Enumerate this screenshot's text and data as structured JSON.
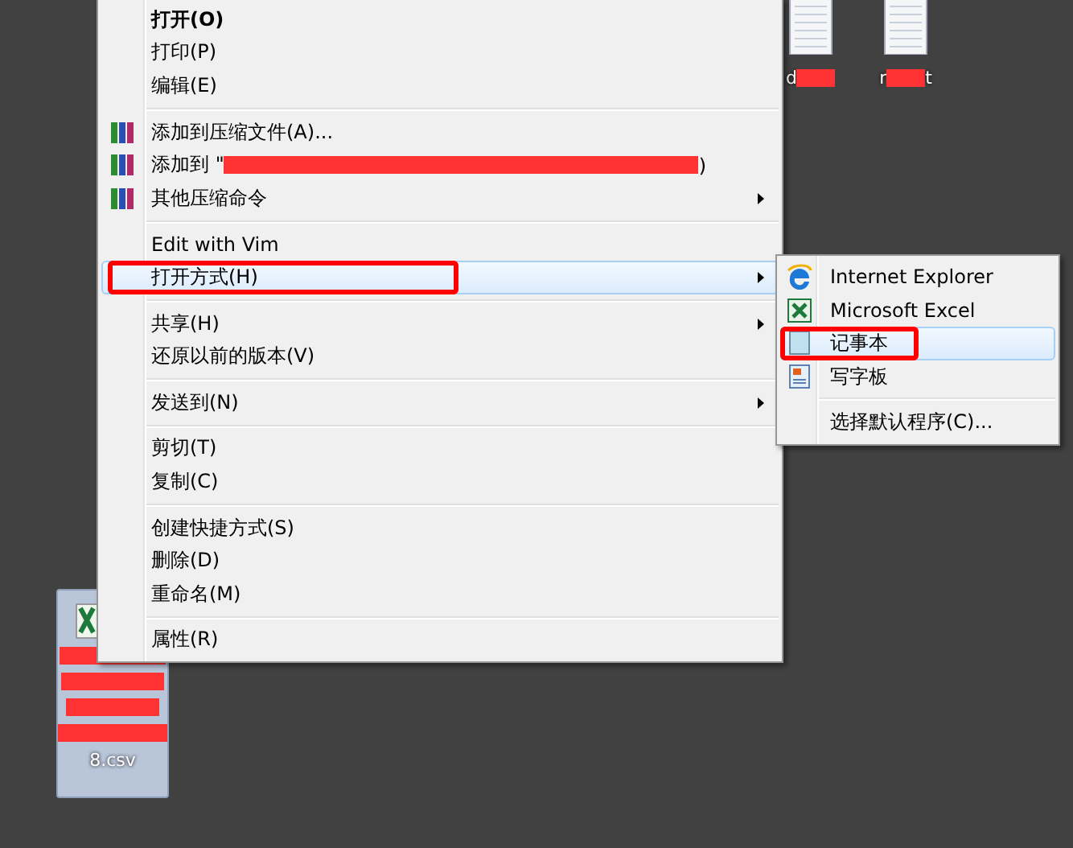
{
  "desktop_files": [
    {
      "kind": "text",
      "label_start": "d",
      "selected": false
    },
    {
      "kind": "text",
      "label_start": "r",
      "label_end": "t",
      "selected": false
    },
    {
      "kind": "excel",
      "label_end": "8.csv",
      "selected": true
    }
  ],
  "context_menu": {
    "groups": [
      [
        {
          "label": "打开(O)",
          "bold": true,
          "submenu": false,
          "selected": false,
          "annotated": false
        },
        {
          "label": "打印(P)",
          "bold": false,
          "submenu": false,
          "selected": false,
          "annotated": false
        },
        {
          "label": "编辑(E)",
          "bold": false,
          "submenu": false,
          "selected": false,
          "annotated": false
        }
      ],
      [
        {
          "label": "添加到压缩文件(A)...",
          "kind": "archive",
          "bold": false,
          "submenu": false,
          "selected": false,
          "annotated": false
        },
        {
          "label": "添加到 \"",
          "label_end": ")",
          "kind": "archive",
          "bold": false,
          "submenu": false,
          "selected": false,
          "annotated": false
        },
        {
          "label": "其他压缩命令",
          "kind": "archive",
          "bold": false,
          "submenu": true,
          "selected": false,
          "annotated": false
        }
      ],
      [
        {
          "label": "Edit with Vim",
          "bold": false,
          "submenu": false,
          "selected": false,
          "annotated": false
        },
        {
          "label": "打开方式(H)",
          "bold": false,
          "submenu": true,
          "selected": true,
          "annotated": true
        }
      ],
      [
        {
          "label": "共享(H)",
          "bold": false,
          "submenu": true,
          "selected": false,
          "annotated": false
        },
        {
          "label": "还原以前的版本(V)",
          "bold": false,
          "submenu": false,
          "selected": false,
          "annotated": false
        }
      ],
      [
        {
          "label": "发送到(N)",
          "bold": false,
          "submenu": true,
          "selected": false,
          "annotated": false
        }
      ],
      [
        {
          "label": "剪切(T)",
          "bold": false,
          "submenu": false,
          "selected": false,
          "annotated": false
        },
        {
          "label": "复制(C)",
          "bold": false,
          "submenu": false,
          "selected": false,
          "annotated": false
        }
      ],
      [
        {
          "label": "创建快捷方式(S)",
          "bold": false,
          "submenu": false,
          "selected": false,
          "annotated": false
        },
        {
          "label": "删除(D)",
          "bold": false,
          "submenu": false,
          "selected": false,
          "annotated": false
        },
        {
          "label": "重命名(M)",
          "bold": false,
          "submenu": false,
          "selected": false,
          "annotated": false
        }
      ],
      [
        {
          "label": "属性(R)",
          "bold": false,
          "submenu": false,
          "selected": false,
          "annotated": false
        }
      ]
    ]
  },
  "open_with_menu": {
    "groups": [
      [
        {
          "label": "Internet Explorer",
          "kind": "ie",
          "selected": false,
          "annotated": false
        },
        {
          "label": "Microsoft Excel",
          "kind": "excel",
          "selected": false,
          "annotated": false
        },
        {
          "label": "记事本",
          "kind": "notepad",
          "selected": true,
          "annotated": true
        },
        {
          "label": "写字板",
          "kind": "wordpad",
          "selected": false,
          "annotated": false
        }
      ],
      [
        {
          "label": "选择默认程序(C)...",
          "selected": false,
          "annotated": false
        }
      ]
    ]
  }
}
